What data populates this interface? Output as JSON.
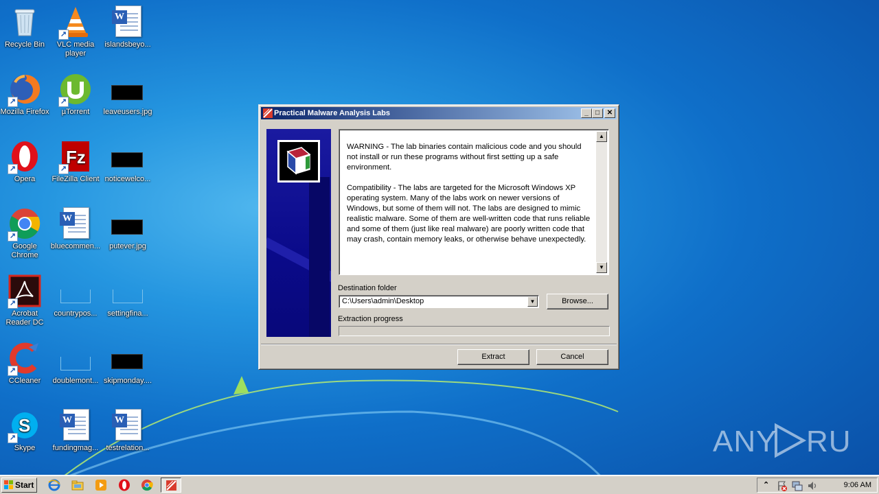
{
  "desktop": {
    "icons": [
      {
        "label": "Recycle Bin"
      },
      {
        "label": "VLC media player"
      },
      {
        "label": "islandsbeyo..."
      },
      {
        "label": "Mozilla Firefox"
      },
      {
        "label": "µTorrent"
      },
      {
        "label": "leaveusers.jpg"
      },
      {
        "label": "Opera"
      },
      {
        "label": "FileZilla Client"
      },
      {
        "label": "noticewelco..."
      },
      {
        "label": "Google Chrome"
      },
      {
        "label": "bluecommen..."
      },
      {
        "label": "putever.jpg"
      },
      {
        "label": "Acrobat Reader DC"
      },
      {
        "label": "countrypos..."
      },
      {
        "label": "settingfina..."
      },
      {
        "label": "CCleaner"
      },
      {
        "label": "doublemont..."
      },
      {
        "label": "skipmonday...."
      },
      {
        "label": "Skype"
      },
      {
        "label": "fundingmag..."
      },
      {
        "label": "testrelation..."
      }
    ]
  },
  "dialog": {
    "title": "Practical Malware Analysis Labs",
    "minimize": "_",
    "maximize": "□",
    "close": "✕",
    "warning_text": "WARNING - The lab binaries contain malicious code and you should not install or run these programs without first setting up a safe environment.",
    "compat_text": "Compatibility - The labs are targeted for the Microsoft Windows XP operating system.  Many of the labs work on newer versions of Windows, but some of them will not.  The labs are designed to mimic realistic malware.  Some of them are well-written code that runs reliable and some of them (just like real malware) are poorly written code that may crash, contain memory leaks, or otherwise behave unexpectedly.",
    "destination_label": "Destination folder",
    "destination_value": "C:\\Users\\admin\\Desktop",
    "browse_label": "Browse...",
    "progress_label": "Extraction progress",
    "progress_value": 0,
    "extract_label": "Extract",
    "cancel_label": "Cancel"
  },
  "taskbar": {
    "start_label": "Start",
    "quick_launch": [
      "internet-explorer-icon",
      "explorer-icon",
      "media-player-icon",
      "opera-icon",
      "chrome-icon"
    ],
    "active_window": "practical-malware-analysis-labs",
    "clock": "9:06 AM"
  },
  "watermark": "ANY RUN"
}
